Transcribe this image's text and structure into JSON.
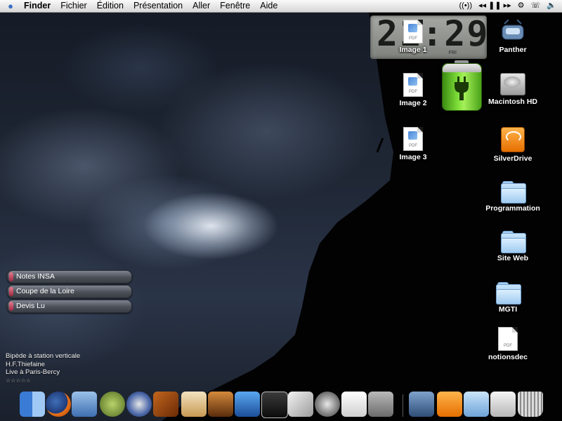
{
  "menubar": {
    "apple_icon": "apple-menu-icon",
    "app_name": "Finder",
    "menus": [
      "Fichier",
      "Édition",
      "Présentation",
      "Aller",
      "Fenêtre",
      "Aide"
    ],
    "status_icons": [
      "airport-icon",
      "itunes-controls-icon",
      "system-gear-icon",
      "phone-icon",
      "volume-icon"
    ]
  },
  "clock": {
    "time": "21:29",
    "day": "FRI"
  },
  "battery": {
    "state": "charging",
    "color": "#7fe03a"
  },
  "desktop_icons": {
    "image1": "Image 1",
    "image2": "Image 2",
    "image3": "Image 3",
    "panther": "Panther",
    "macintosh_hd": "Macintosh HD",
    "silverdrive": "SilverDrive",
    "programmation": "Programmation",
    "site_web": "Site Web",
    "mgti": "MGTI",
    "notionsdec": "notionsdec",
    "pdf_tag": "PDF"
  },
  "shortcuts": [
    "Notes INSA",
    "Coupe de la Loire",
    "Devis Lu"
  ],
  "itunes": {
    "track": "Bipède à station verticale",
    "artist": "H.F.Thiefaine",
    "album": "Live à Paris-Bercy",
    "rating": "☆☆☆☆☆"
  },
  "dock": {
    "apps": [
      "finder-icon",
      "firefox-icon",
      "mail-icon",
      "adium-icon",
      "yoda-icon",
      "network-icon",
      "instruments-icon",
      "address-book-icon",
      "photo-icon",
      "imovie-icon",
      "terminal-icon",
      "script-editor-icon",
      "itunes-icon",
      "textedit-icon",
      "system-icon"
    ],
    "docs": [
      "panther-drive-icon",
      "silverdrive-icon",
      "applications-folder-icon",
      "home-folder-icon",
      "trash-icon"
    ]
  }
}
